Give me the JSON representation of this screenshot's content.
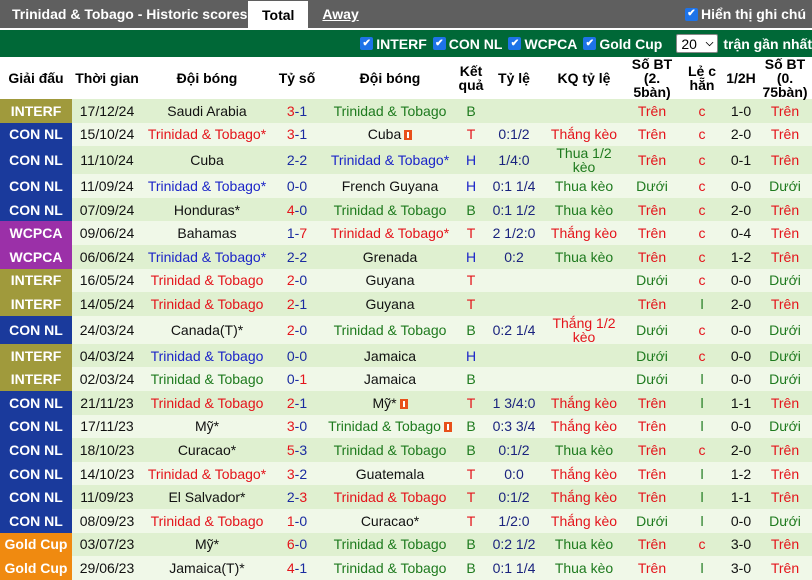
{
  "header": {
    "title": "Trinidad & Tobago - Historic scores",
    "tabs": [
      {
        "label": "Total",
        "active": true
      },
      {
        "label": "Away",
        "active": false
      }
    ],
    "show_notes_label": "Hiển thị ghi chú",
    "show_notes_checked": true
  },
  "filters": {
    "leagues": [
      {
        "label": "INTERF",
        "checked": true
      },
      {
        "label": "CON NL",
        "checked": true
      },
      {
        "label": "WCPCA",
        "checked": true
      },
      {
        "label": "Gold Cup",
        "checked": true
      }
    ],
    "count_value": "20",
    "count_suffix": "trận gần nhất"
  },
  "colors": {
    "INTERF": "#a09a3c",
    "CON NL": "#1a3a9c",
    "WCPCA": "#9b30a8",
    "Gold Cup": "#f08a10",
    "header_bar": "#5f5f5f",
    "filter_bar": "#006837"
  },
  "columns": [
    "Giải đấu",
    "Thời gian",
    "Đội bóng",
    "Tỷ số",
    "Đội bóng",
    "Kết quả",
    "Tỷ lệ",
    "KQ tỷ lệ",
    "Số BT (2.5bàn)",
    "Lẻ chẵn",
    "1/2H",
    "Số BT (0.75bàn)"
  ],
  "column_labels_wrapped": {
    "result": [
      "Kết",
      "quả"
    ],
    "bt25": [
      "Số BT (2.",
      "5bàn)"
    ],
    "oddeven": [
      "Lẻ c",
      "hẵn"
    ],
    "bt075": [
      "Số BT (0.",
      "75bàn)"
    ]
  },
  "rows": [
    {
      "league": "INTERF",
      "date": "17/12/24",
      "home": "Saudi Arabia",
      "home_c": "black",
      "hs": "3",
      "as": "1",
      "away": "Trinidad & Tobago",
      "away_c": "green",
      "away_card": false,
      "home_card": false,
      "res": "B",
      "res_c": "green",
      "hc": "",
      "hc_res": "",
      "hc_res_c": "",
      "ou": "Trên",
      "oe": "c",
      "ht": "1-0",
      "ou2": "Trên"
    },
    {
      "league": "CON NL",
      "date": "15/10/24",
      "home": "Trinidad & Tobago*",
      "home_c": "red",
      "hs": "3",
      "as": "1",
      "away": "Cuba",
      "away_c": "black",
      "away_card": true,
      "home_card": false,
      "res": "T",
      "res_c": "red",
      "hc": "0:1/2",
      "hc_res": "Thắng kèo",
      "hc_res_c": "red",
      "ou": "Trên",
      "oe": "c",
      "ht": "2-0",
      "ou2": "Trên"
    },
    {
      "league": "CON NL",
      "date": "11/10/24",
      "home": "Cuba",
      "home_c": "black",
      "hs": "2",
      "as": "2",
      "away": "Trinidad & Tobago*",
      "away_c": "blue",
      "away_card": false,
      "home_card": false,
      "res": "H",
      "res_c": "blue",
      "hc": "1/4:0",
      "hc_res": "Thua 1/2 kèo",
      "hc_res_c": "green",
      "ou": "Trên",
      "oe": "c",
      "ht": "0-1",
      "ou2": "Trên",
      "tall": true
    },
    {
      "league": "CON NL",
      "date": "11/09/24",
      "home": "Trinidad & Tobago*",
      "home_c": "blue",
      "hs": "0",
      "as": "0",
      "away": "French Guyana",
      "away_c": "black",
      "away_card": false,
      "home_card": false,
      "res": "H",
      "res_c": "blue",
      "hc": "0:1 1/4",
      "hc_res": "Thua kèo",
      "hc_res_c": "green",
      "ou": "Dưới",
      "oe": "c",
      "ht": "0-0",
      "ou2": "Dưới"
    },
    {
      "league": "CON NL",
      "date": "07/09/24",
      "home": "Honduras*",
      "home_c": "black",
      "hs": "4",
      "as": "0",
      "away": "Trinidad & Tobago",
      "away_c": "green",
      "away_card": false,
      "home_card": false,
      "res": "B",
      "res_c": "green",
      "hc": "0:1 1/2",
      "hc_res": "Thua kèo",
      "hc_res_c": "green",
      "ou": "Trên",
      "oe": "c",
      "ht": "2-0",
      "ou2": "Trên"
    },
    {
      "league": "WCPCA",
      "date": "09/06/24",
      "home": "Bahamas",
      "home_c": "black",
      "hs": "1",
      "as": "7",
      "away": "Trinidad & Tobago*",
      "away_c": "red",
      "away_card": false,
      "home_card": false,
      "res": "T",
      "res_c": "red",
      "hc": "2 1/2:0",
      "hc_res": "Thắng kèo",
      "hc_res_c": "red",
      "ou": "Trên",
      "oe": "c",
      "ht": "0-4",
      "ou2": "Trên"
    },
    {
      "league": "WCPCA",
      "date": "06/06/24",
      "home": "Trinidad & Tobago*",
      "home_c": "blue",
      "hs": "2",
      "as": "2",
      "away": "Grenada",
      "away_c": "black",
      "away_card": false,
      "home_card": false,
      "res": "H",
      "res_c": "blue",
      "hc": "0:2",
      "hc_res": "Thua kèo",
      "hc_res_c": "green",
      "ou": "Trên",
      "oe": "c",
      "ht": "1-2",
      "ou2": "Trên"
    },
    {
      "league": "INTERF",
      "date": "16/05/24",
      "home": "Trinidad & Tobago",
      "home_c": "red",
      "hs": "2",
      "as": "0",
      "away": "Guyana",
      "away_c": "black",
      "away_card": false,
      "home_card": false,
      "res": "T",
      "res_c": "red",
      "hc": "",
      "hc_res": "",
      "hc_res_c": "",
      "ou": "Dưới",
      "oe": "c",
      "ht": "0-0",
      "ou2": "Dưới"
    },
    {
      "league": "INTERF",
      "date": "14/05/24",
      "home": "Trinidad & Tobago",
      "home_c": "red",
      "hs": "2",
      "as": "1",
      "away": "Guyana",
      "away_c": "black",
      "away_card": false,
      "home_card": false,
      "res": "T",
      "res_c": "red",
      "hc": "",
      "hc_res": "",
      "hc_res_c": "",
      "ou": "Trên",
      "oe": "l",
      "ht": "2-0",
      "ou2": "Trên"
    },
    {
      "league": "CON NL",
      "date": "24/03/24",
      "home": "Canada(T)*",
      "home_c": "black",
      "hs": "2",
      "as": "0",
      "away": "Trinidad & Tobago",
      "away_c": "green",
      "away_card": false,
      "home_card": false,
      "res": "B",
      "res_c": "green",
      "hc": "0:2 1/4",
      "hc_res": "Thắng 1/2 kèo",
      "hc_res_c": "red",
      "ou": "Dưới",
      "oe": "c",
      "ht": "0-0",
      "ou2": "Dưới",
      "tall": true
    },
    {
      "league": "INTERF",
      "date": "04/03/24",
      "home": "Trinidad & Tobago",
      "home_c": "blue",
      "hs": "0",
      "as": "0",
      "away": "Jamaica",
      "away_c": "black",
      "away_card": false,
      "home_card": false,
      "res": "H",
      "res_c": "blue",
      "hc": "",
      "hc_res": "",
      "hc_res_c": "",
      "ou": "Dưới",
      "oe": "c",
      "ht": "0-0",
      "ou2": "Dưới"
    },
    {
      "league": "INTERF",
      "date": "02/03/24",
      "home": "Trinidad & Tobago",
      "home_c": "green",
      "hs": "0",
      "as": "1",
      "away": "Jamaica",
      "away_c": "black",
      "away_card": false,
      "home_card": false,
      "res": "B",
      "res_c": "green",
      "hc": "",
      "hc_res": "",
      "hc_res_c": "",
      "ou": "Dưới",
      "oe": "l",
      "ht": "0-0",
      "ou2": "Dưới"
    },
    {
      "league": "CON NL",
      "date": "21/11/23",
      "home": "Trinidad & Tobago",
      "home_c": "red",
      "hs": "2",
      "as": "1",
      "away": "Mỹ*",
      "away_c": "black",
      "away_card": true,
      "home_card": false,
      "res": "T",
      "res_c": "red",
      "hc": "1 3/4:0",
      "hc_res": "Thắng kèo",
      "hc_res_c": "red",
      "ou": "Trên",
      "oe": "l",
      "ht": "1-1",
      "ou2": "Trên"
    },
    {
      "league": "CON NL",
      "date": "17/11/23",
      "home": "Mỹ*",
      "home_c": "black",
      "hs": "3",
      "as": "0",
      "away": "Trinidad & Tobago",
      "away_c": "green",
      "away_card": true,
      "home_card": false,
      "res": "B",
      "res_c": "green",
      "hc": "0:3 3/4",
      "hc_res": "Thắng kèo",
      "hc_res_c": "red",
      "ou": "Trên",
      "oe": "l",
      "ht": "0-0",
      "ou2": "Dưới"
    },
    {
      "league": "CON NL",
      "date": "18/10/23",
      "home": "Curacao*",
      "home_c": "black",
      "hs": "5",
      "as": "3",
      "away": "Trinidad & Tobago",
      "away_c": "green",
      "away_card": false,
      "home_card": false,
      "res": "B",
      "res_c": "green",
      "hc": "0:1/2",
      "hc_res": "Thua kèo",
      "hc_res_c": "green",
      "ou": "Trên",
      "oe": "c",
      "ht": "2-0",
      "ou2": "Trên"
    },
    {
      "league": "CON NL",
      "date": "14/10/23",
      "home": "Trinidad & Tobago*",
      "home_c": "red",
      "hs": "3",
      "as": "2",
      "away": "Guatemala",
      "away_c": "black",
      "away_card": false,
      "home_card": false,
      "res": "T",
      "res_c": "red",
      "hc": "0:0",
      "hc_res": "Thắng kèo",
      "hc_res_c": "red",
      "ou": "Trên",
      "oe": "l",
      "ht": "1-2",
      "ou2": "Trên"
    },
    {
      "league": "CON NL",
      "date": "11/09/23",
      "home": "El Salvador*",
      "home_c": "black",
      "hs": "2",
      "as": "3",
      "away": "Trinidad & Tobago",
      "away_c": "red",
      "away_card": false,
      "home_card": false,
      "res": "T",
      "res_c": "red",
      "hc": "0:1/2",
      "hc_res": "Thắng kèo",
      "hc_res_c": "red",
      "ou": "Trên",
      "oe": "l",
      "ht": "1-1",
      "ou2": "Trên"
    },
    {
      "league": "CON NL",
      "date": "08/09/23",
      "home": "Trinidad & Tobago",
      "home_c": "red",
      "hs": "1",
      "as": "0",
      "away": "Curacao*",
      "away_c": "black",
      "away_card": false,
      "home_card": false,
      "res": "T",
      "res_c": "red",
      "hc": "1/2:0",
      "hc_res": "Thắng kèo",
      "hc_res_c": "red",
      "ou": "Dưới",
      "oe": "l",
      "ht": "0-0",
      "ou2": "Dưới"
    },
    {
      "league": "Gold Cup",
      "date": "03/07/23",
      "home": "Mỹ*",
      "home_c": "black",
      "hs": "6",
      "as": "0",
      "away": "Trinidad & Tobago",
      "away_c": "green",
      "away_card": false,
      "home_card": false,
      "res": "B",
      "res_c": "green",
      "hc": "0:2 1/2",
      "hc_res": "Thua kèo",
      "hc_res_c": "green",
      "ou": "Trên",
      "oe": "c",
      "ht": "3-0",
      "ou2": "Trên"
    },
    {
      "league": "Gold Cup",
      "date": "29/06/23",
      "home": "Jamaica(T)*",
      "home_c": "black",
      "hs": "4",
      "as": "1",
      "away": "Trinidad & Tobago",
      "away_c": "green",
      "away_card": false,
      "home_card": false,
      "res": "B",
      "res_c": "green",
      "hc": "0:1 1/4",
      "hc_res": "Thua kèo",
      "hc_res_c": "green",
      "ou": "Trên",
      "oe": "l",
      "ht": "3-0",
      "ou2": "Trên"
    }
  ]
}
